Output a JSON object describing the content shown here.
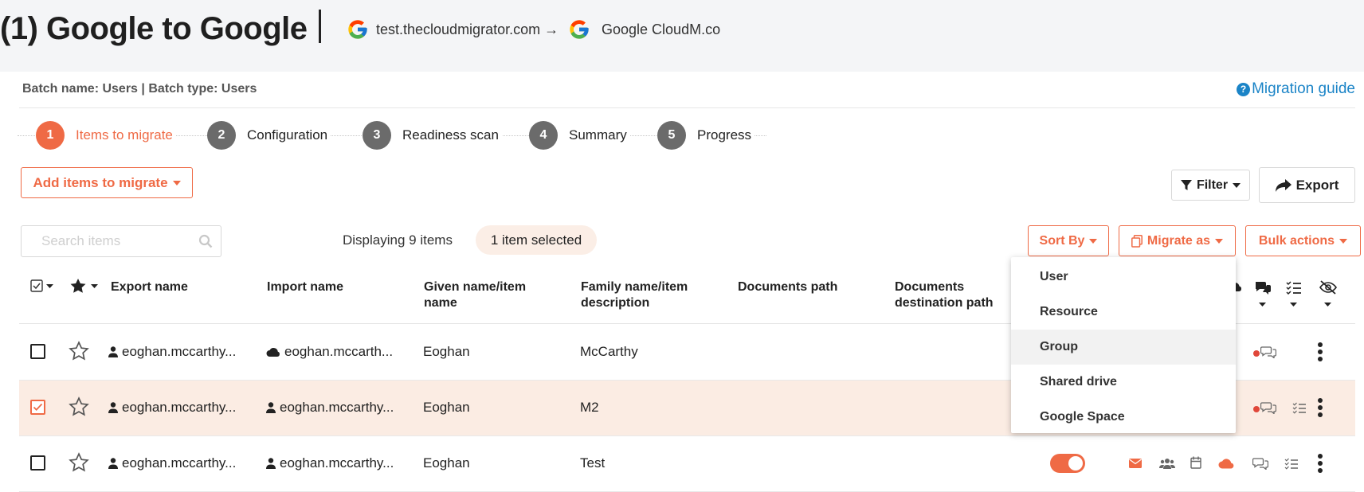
{
  "header": {
    "title": "(1) Google to Google",
    "source_domain": "test.thecloudmigrator.com →",
    "destination_label": "Google CloudM.co"
  },
  "batch": {
    "info": "Batch name: Users | Batch type: Users",
    "guide_link": "Migration guide"
  },
  "stepper": [
    {
      "num": "1",
      "label": "Items to migrate",
      "active": true
    },
    {
      "num": "2",
      "label": "Configuration"
    },
    {
      "num": "3",
      "label": "Readiness scan"
    },
    {
      "num": "4",
      "label": "Summary"
    },
    {
      "num": "5",
      "label": "Progress"
    }
  ],
  "toolbar": {
    "add_items_label": "Add items to migrate",
    "filter_label": "Filter",
    "export_label": "Export",
    "search_placeholder": "Search items",
    "displaying_text": "Displaying 9 items",
    "selected_text": "1 item selected",
    "sort_by_label": "Sort By",
    "migrate_as_label": "Migrate as",
    "bulk_actions_label": "Bulk actions"
  },
  "table": {
    "headers": {
      "export_name": "Export name",
      "import_name": "Import name",
      "given_name_1": "Given name/item",
      "given_name_2": "name",
      "family_name_1": "Family name/item",
      "family_name_2": "description",
      "documents_path": "Documents path",
      "documents_dest_1": "Documents",
      "documents_dest_2": "destination path"
    },
    "rows": [
      {
        "export_name": "eoghan.mccarthy...",
        "import_name": "eoghan.mccarth...",
        "import_icon": "cloud-icon",
        "given_name": "Eoghan",
        "family_name": "McCarthy",
        "checked": false
      },
      {
        "export_name": "eoghan.mccarthy...",
        "import_name": "eoghan.mccarthy...",
        "import_icon": "user-icon",
        "given_name": "Eoghan",
        "family_name": "M2",
        "checked": true
      },
      {
        "export_name": "eoghan.mccarthy...",
        "import_name": "eoghan.mccarthy...",
        "import_icon": "user-icon",
        "given_name": "Eoghan",
        "family_name": "Test",
        "checked": false
      }
    ]
  },
  "migrate_as_menu": {
    "items": [
      "User",
      "Resource",
      "Group",
      "Shared drive",
      "Google Space"
    ],
    "hovered": "Group"
  },
  "colors": {
    "accent": "#ef6a45",
    "link": "#1b84c7",
    "selected_row": "#fbece3",
    "step_inactive": "#6b6b6b"
  }
}
